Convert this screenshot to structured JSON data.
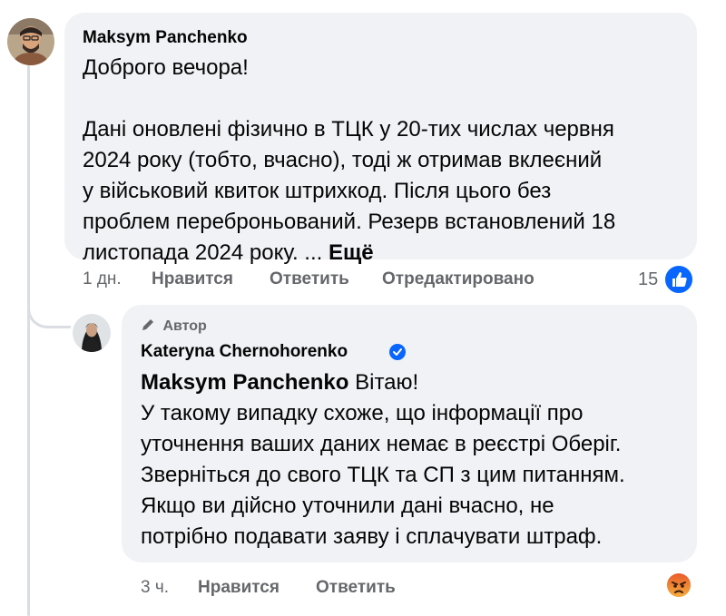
{
  "comment1": {
    "author": "Maksym Panchenko",
    "lines": [
      "Доброго вечора!",
      "",
      "Дані оновлені фізично в ТЦК у 20-тих числах червня",
      "2024 року (тобто, вчасно), тоді ж отримав вклеєний",
      "у військовий квиток штрихкод. Після цього без",
      "проблем переброньований. Резерв встановлений 18",
      "листопада 2024 року. ... "
    ],
    "more_label": "Ещё",
    "time": "1 дн.",
    "like_label": "Нравится",
    "reply_label": "Ответить",
    "edited_label": "Отредактировано",
    "reaction_count": "15",
    "reaction_icon": "like-icon"
  },
  "comment2": {
    "badge_label": "Автор",
    "badge_icon": "pencil-icon",
    "author": "Kateryna Chernohorenko",
    "verified_icon": "verified-badge-icon",
    "mention": "Maksym Panchenko",
    "first_line_rest": " Вітаю!",
    "lines": [
      "У такому випадку схоже, що інформації про",
      "уточнення ваших даних немає в реєстрі Оберіг.",
      "Зверніться до свого ТЦК та СП з цим питанням.",
      "Якщо ви дійсно уточнили дані вчасно, не",
      "потрібно подавати заяву і сплачувати штраф."
    ],
    "time": "3 ч.",
    "like_label": "Нравится",
    "reply_label": "Ответить",
    "reaction_icon": "angry-icon"
  },
  "colors": {
    "bubble_bg": "#f0f2f5",
    "meta_text": "#65676b",
    "like_blue": "#0866ff",
    "angry_orange": "#e8582a"
  }
}
